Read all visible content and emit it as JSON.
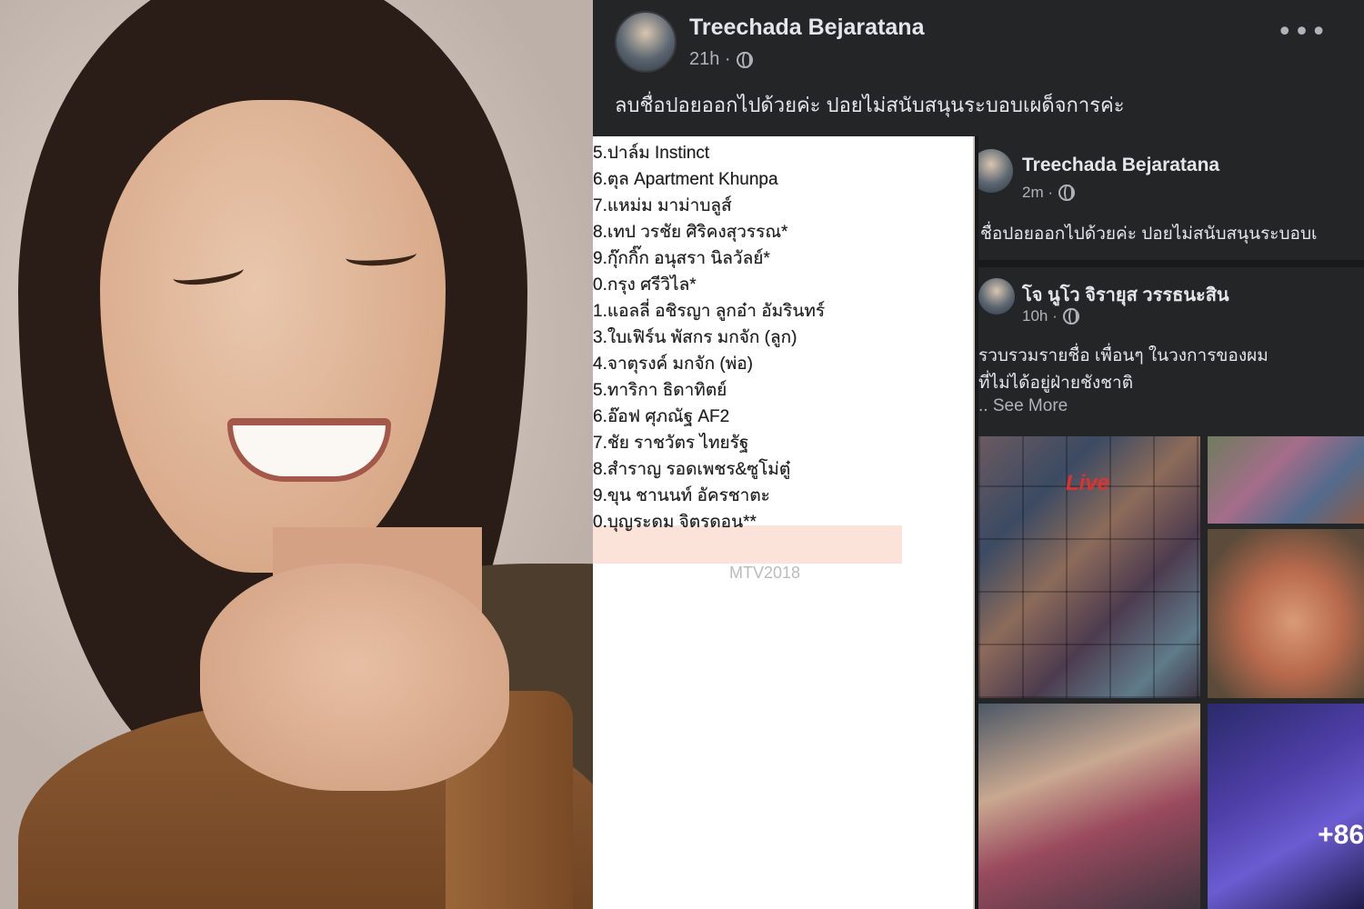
{
  "post": {
    "author": "Treechada Bejaratana",
    "time": "21h ·",
    "text": "ลบชื่อปอยออกไปด้วยค่ะ ปอยไม่สนับสนุนระบอบเผด็จการค่ะ",
    "more_icon": "•••"
  },
  "list": {
    "items": [
      "5.ปาล์ม Instinct",
      "6.ตุล Apartment Khunpa",
      "7.แหม่ม มาม่าบลูส์",
      "8.เทป วรชัย ศิริคงสุวรรณ*",
      "9.กุ๊กกิ๊ก อนุสรา นิลวัลย์*",
      "0.กรุง ศรีวิไล*",
      "1.แอลลี่ อชิรญา ลูกอ๋า อัมรินทร์",
      "3.ใบเฟิร์น พัสกร มกจัก (ลูก)",
      "4.จาตุรงค์ มกจัก (พ่อ)",
      "5.ทาริกา ธิดาทิตย์",
      "6.อ๊อฟ ศุภณัฐ AF2",
      "7.ชัย ราชวัตร ไทยรัฐ",
      "8.สำราญ รอดเพชร&ซูโม่ตู๋",
      "9.ขุน ชานนท์ อัครชาตะ",
      "0.บุญระดม จิตรดอน**"
    ],
    "faded_row": "MTV2018"
  },
  "nested": {
    "author": "Treechada Bejaratana",
    "time": "2m ·",
    "text": "ชื่อปอยออกไปด้วยค่ะ ปอยไม่สนับสนุนระบอบเ",
    "shared": {
      "author": "โจ นูโว จิรายุส วรรธนะสิน",
      "time": "10h ·",
      "line1": "รวบรวมรายชื่อ เพื่อนๆ ในวงการของผม",
      "line2": "ที่ไม่ได้อยู่ฝ่ายชังชาติ",
      "see_more": ".. See More",
      "live_badge": "Live",
      "more_photos": "+86"
    }
  }
}
